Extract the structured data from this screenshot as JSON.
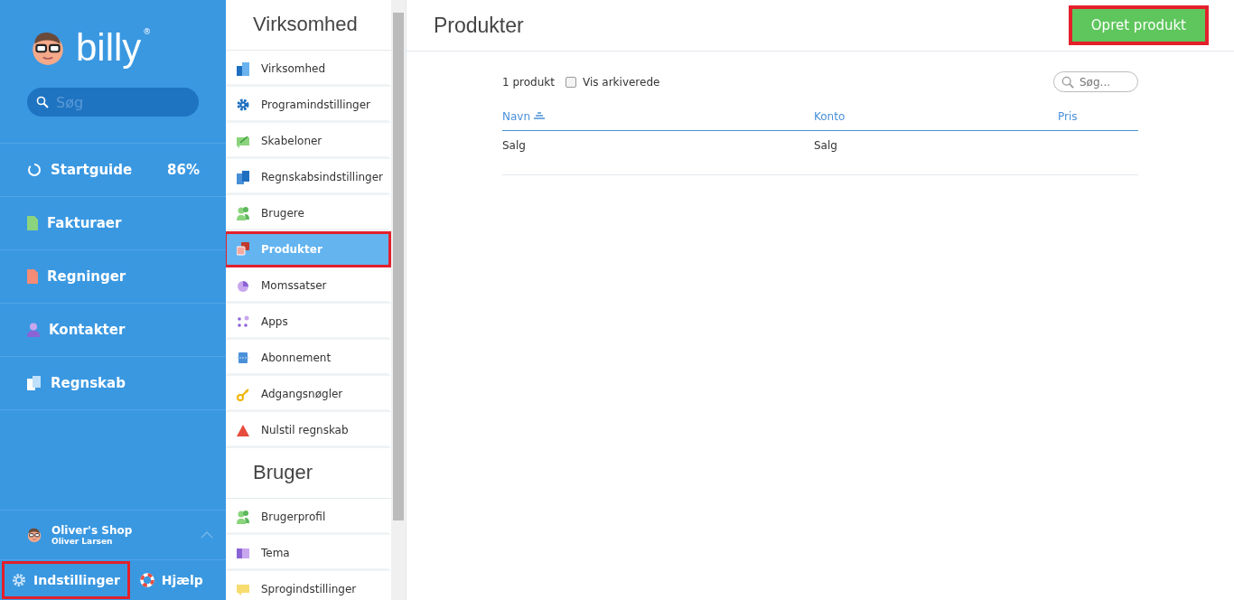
{
  "sidebar": {
    "logo": "billy",
    "logo_mark": "®",
    "search": {
      "placeholder": "Søg"
    },
    "nav": [
      {
        "label": "Startguide",
        "badge": "86%"
      },
      {
        "label": "Fakturaer"
      },
      {
        "label": "Regninger"
      },
      {
        "label": "Kontakter"
      },
      {
        "label": "Regnskab"
      }
    ],
    "account": {
      "company": "Oliver's Shop",
      "user": "Oliver Larsen"
    },
    "footer": [
      {
        "label": "Indstillinger",
        "highlighted": true
      },
      {
        "label": "Hjælp",
        "highlighted": false
      }
    ]
  },
  "settings_menu": {
    "sections": [
      {
        "title": "Virksomhed",
        "items": [
          {
            "label": "Virksomhed",
            "selected": false,
            "highlighted": false
          },
          {
            "label": "Programindstillinger",
            "selected": false,
            "highlighted": false
          },
          {
            "label": "Skabeloner",
            "selected": false,
            "highlighted": false
          },
          {
            "label": "Regnskabsindstillinger",
            "selected": false,
            "highlighted": false
          },
          {
            "label": "Brugere",
            "selected": false,
            "highlighted": false
          },
          {
            "label": "Produkter",
            "selected": true,
            "highlighted": true
          },
          {
            "label": "Momssatser",
            "selected": false,
            "highlighted": false
          },
          {
            "label": "Apps",
            "selected": false,
            "highlighted": false
          },
          {
            "label": "Abonnement",
            "selected": false,
            "highlighted": false
          },
          {
            "label": "Adgangsnøgler",
            "selected": false,
            "highlighted": false
          },
          {
            "label": "Nulstil regnskab",
            "selected": false,
            "highlighted": false
          }
        ]
      },
      {
        "title": "Bruger",
        "items": [
          {
            "label": "Brugerprofil",
            "selected": false,
            "highlighted": false
          },
          {
            "label": "Tema",
            "selected": false,
            "highlighted": false
          },
          {
            "label": "Sprogindstillinger",
            "selected": false,
            "highlighted": false
          }
        ]
      }
    ]
  },
  "main": {
    "title": "Produkter",
    "create_button": {
      "label": "Opret produkt",
      "highlighted": true
    },
    "count": "1 produkt",
    "show_archived": {
      "label": "Vis arkiverede",
      "checked": false
    },
    "search": {
      "placeholder": "Søg..."
    },
    "table": {
      "columns": [
        {
          "label": "Navn",
          "sorted": true
        },
        {
          "label": "Konto",
          "sorted": false
        },
        {
          "label": "Pris",
          "sorted": false
        }
      ],
      "rows": [
        [
          "Salg",
          "Salg",
          ""
        ]
      ]
    }
  }
}
